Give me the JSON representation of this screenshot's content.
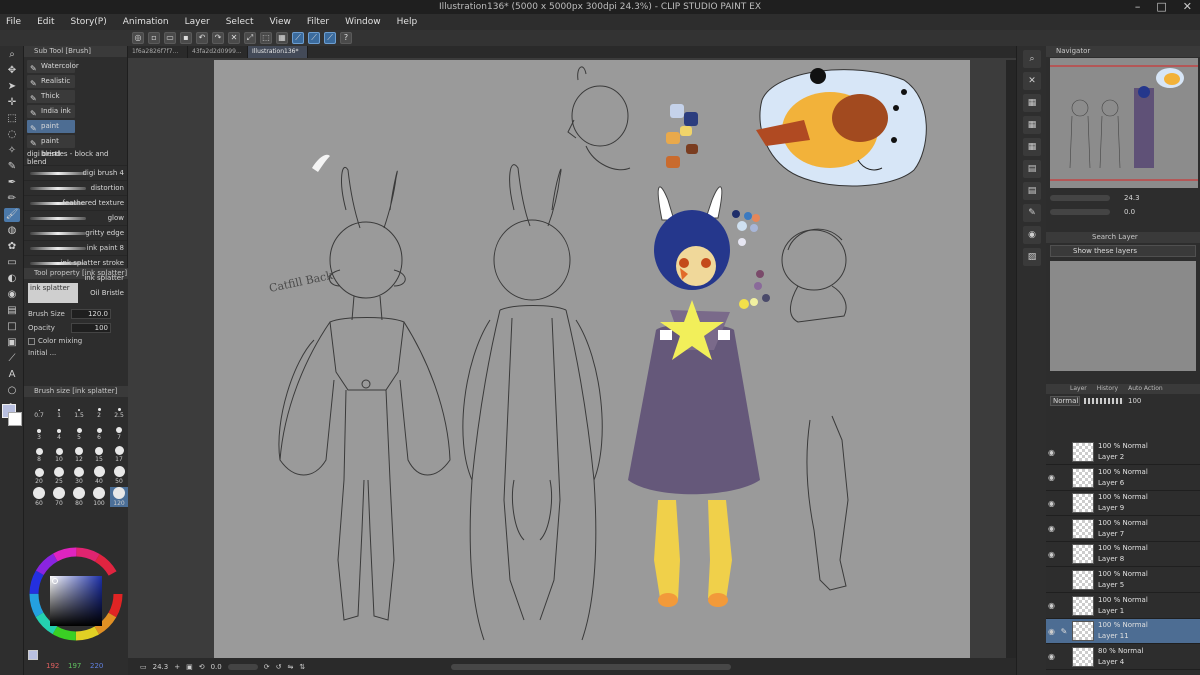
{
  "titlebar": {
    "title": "Illustration136* (5000 x 5000px 300dpi 24.3%)  - CLIP STUDIO PAINT EX"
  },
  "menu": [
    "File",
    "Edit",
    "Story(P)",
    "Animation",
    "Layer",
    "Select",
    "View",
    "Filter",
    "Window",
    "Help"
  ],
  "window_controls": [
    "–",
    "□",
    "✕"
  ],
  "doc_tabs": [
    "1f6a2826f7f7...",
    "43fa2d2d0999...",
    "Illustration136*"
  ],
  "subtool": {
    "header": "Sub Tool [Brush]",
    "tabs": [
      "Watercolor",
      "Realistic w",
      "Thick paint",
      "India ink",
      "paint blend",
      "paint blend"
    ],
    "brushes": [
      "digi bristles - block and blend",
      "digi brush 4",
      "distortion",
      "feathered texture",
      "glow",
      "gritty edge",
      "ink paint 8",
      "ink splatter stroke",
      "ink splatter",
      "Oil Bristle"
    ]
  },
  "toolprop": {
    "header": "Tool property [ink splatter]",
    "preview_label": "ink splatter",
    "brush_size_label": "Brush Size",
    "brush_size_value": "120.0",
    "opacity_label": "Opacity",
    "opacity_value": "100",
    "color_mixing_label": "Color mixing",
    "last_label": "Initial ..."
  },
  "brushsize": {
    "header": "Brush size [ink splatter]",
    "sizes": [
      "0.7",
      "1",
      "1.5",
      "2",
      "2.5",
      "3",
      "4",
      "5",
      "6",
      "7",
      "8",
      "10",
      "12",
      "15",
      "17",
      "20",
      "25",
      "30",
      "40",
      "50",
      "60",
      "70",
      "80",
      "100",
      "120"
    ],
    "active": "120"
  },
  "color": {
    "rgb_r": "192",
    "rgb_g": "197",
    "rgb_b": "220",
    "main": "#b9c0e0",
    "hue_square": "#1c2fa8"
  },
  "status": {
    "zoom": "24.3",
    "angle": "0.0"
  },
  "canvas_text": {
    "note": "Catfill Back"
  },
  "palette_swatches": [
    "#c5d2ea",
    "#2c3d7e",
    "#e9a94b",
    "#f0d46a",
    "#c96b2e",
    "#7a3d20"
  ],
  "navigator": {
    "header": "Navigator",
    "zoom": "24.3",
    "angle": "0.0"
  },
  "searchlayer": {
    "header": "Search Layer",
    "dropdown": "Show these layers"
  },
  "layer": {
    "tabs": [
      "Layer",
      "History",
      "Auto Action"
    ],
    "blend_mode": "Normal",
    "opacity": "100",
    "rows": [
      {
        "mode": "100 % Normal",
        "name": "Layer 2",
        "visible": true,
        "active": false
      },
      {
        "mode": "100 % Normal",
        "name": "Layer 6",
        "visible": true,
        "active": false
      },
      {
        "mode": "100 % Normal",
        "name": "Layer 9",
        "visible": true,
        "active": false
      },
      {
        "mode": "100 % Normal",
        "name": "Layer 7",
        "visible": true,
        "active": false
      },
      {
        "mode": "100 % Normal",
        "name": "Layer 8",
        "visible": true,
        "active": false
      },
      {
        "mode": "100 % Normal",
        "name": "Layer 5",
        "visible": false,
        "active": false
      },
      {
        "mode": "100 % Normal",
        "name": "Layer 1",
        "visible": true,
        "active": false
      },
      {
        "mode": "100 % Normal",
        "name": "Layer 11",
        "visible": true,
        "active": true
      },
      {
        "mode": "80 % Normal",
        "name": "Layer 4",
        "visible": true,
        "active": false
      }
    ]
  }
}
